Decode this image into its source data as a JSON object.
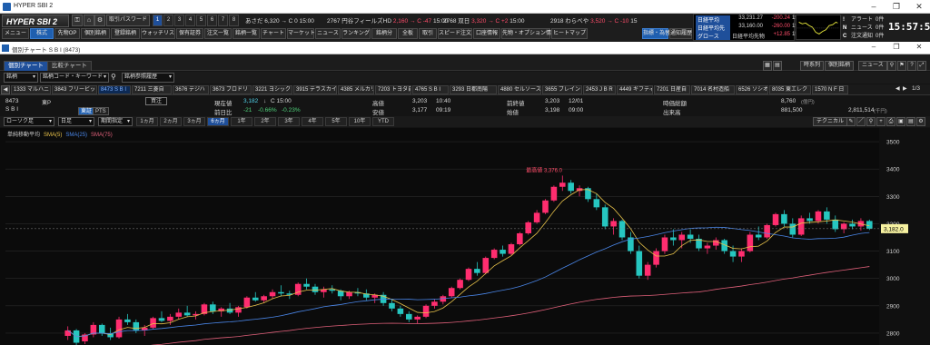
{
  "window": {
    "title": "HYPER SBI 2"
  },
  "toolbar": {
    "brand": "HYPER SBI 2",
    "password_btn": "取引パスワード",
    "num_tabs": [
      "1",
      "2",
      "3",
      "4",
      "5",
      "6",
      "7",
      "8"
    ],
    "tickers": [
      {
        "text": "あさだ 6,320 → C 0 15:00"
      },
      {
        "text": "2767 円谷フィールズHD",
        "price": "2,160",
        "chg": "→ C -47",
        "time": "15:00"
      },
      {
        "text": "2768 双日",
        "price": "3,320",
        "chg": "→ C +2",
        "time": "15:00"
      },
      {
        "text": "2918 わらべや",
        "price": "3,520",
        "chg": "→ C -10",
        "time": "15"
      }
    ],
    "nav_left": [
      "メニュー",
      "株式",
      "先物OP",
      "個別銘柄",
      "登録銘柄",
      "ウォッチリスト",
      "保有証券",
      "注文一覧",
      "銘柄一覧",
      "チャート",
      "マーケット",
      "ニュース",
      "ランキング",
      "銘柄分",
      "全板",
      "取引",
      "スピード注文",
      "口座情報",
      "先物・オプション情報",
      "ヒートマップ"
    ],
    "nav_right": [
      "指標・為替",
      "通知履歴"
    ]
  },
  "indices": [
    {
      "label": "日経平均",
      "value": "33,231.27",
      "chg": "-200.24",
      "time": "15:15"
    },
    {
      "label": "日経平均先",
      "value": "33,160.00",
      "chg": "-260.00",
      "time": "15:15"
    },
    {
      "label": "グロース",
      "value": "日経平均先物",
      "chg": "+12.85",
      "time": "15:15"
    }
  ],
  "alerts": [
    {
      "icon": "!",
      "label": "アラート",
      "count": "0件"
    },
    {
      "icon": "N",
      "label": "ニュース",
      "count": "0件"
    },
    {
      "icon": "C",
      "label": "注文通知",
      "count": "0件"
    }
  ],
  "clock": "15:57:55",
  "subwindow": {
    "title": "個別チャート S B I (8473)"
  },
  "chart_tabs": {
    "tabs": [
      "個別チャート",
      "比較チャート"
    ],
    "right_buttons": [
      "時系列",
      "個別銘柄",
      "ニュース"
    ]
  },
  "search": {
    "type": "銘柄",
    "placeholder": "銘柄コード・キーワード",
    "history": "銘柄参照履歴"
  },
  "stock_tabs": [
    "1333 マルハニ",
    "3843 フリービット",
    "8473 S B I",
    "7211 三菱自",
    "3676 デジハ",
    "3673 ブロドリ",
    "3221 ヨシック",
    "3915 テラスカイ",
    "4385 メルカリ",
    "7203 トヨタ自",
    "4765 S B I",
    "3293 日都南陽",
    "4880 セルソース",
    "3655 ブレイン",
    "2453 J B R",
    "4449 ギフティ",
    "7201 日産自",
    "7014 名村造船",
    "6526 ソシオ",
    "8035 東エレク",
    "1570 N F 日"
  ],
  "stock_tabs_page": "1/3",
  "quote": {
    "code": "8473",
    "name": "S B I",
    "market_label": "東P",
    "markets": [
      "東証",
      "PTS"
    ],
    "buy_btn": "買注",
    "current_label": "現在値",
    "current": "3,182",
    "current_time": "C 15:00",
    "change_label": "前日比",
    "change": "-21",
    "change_pct": "-0.66%",
    "change_pct2": "-0.23%",
    "open_label": "始値",
    "open": "3,203",
    "open_time": "10:40",
    "high_label": "高値",
    "high": "3,203",
    "high_time": "10:40",
    "low_label": "安値",
    "low": "3,177",
    "low_time": "09:19",
    "prev_label": "前終値",
    "prev": "3,203",
    "prev_date": "12/01",
    "start_label": "始値",
    "start": "3,198",
    "start_time": "09:00",
    "value_label": "時価総額",
    "value": "8,760",
    "value_unit": "(億円)",
    "volume_label": "出来高",
    "volume": "881,500",
    "turnover": "2,811,514",
    "turnover_unit": "(千円)"
  },
  "controls": {
    "chart_type": "ローソク足",
    "interval": "日足",
    "period_label": "期間指定",
    "periods": [
      "1ヵ月",
      "2ヵ月",
      "3ヵ月",
      "6ヵ月",
      "1年",
      "2年",
      "3年",
      "4年",
      "5年",
      "10年",
      "YTD"
    ],
    "selected_period": "6ヵ月",
    "technical_btn": "テクニカル"
  },
  "chart_data": {
    "type": "candlestick",
    "legend": [
      "単純移動平均",
      "SMA(5)",
      "SMA(25)",
      "SMA(75)"
    ],
    "legend_colors": [
      "#cccccc",
      "#e8c24a",
      "#4a86e8",
      "#e0607a"
    ],
    "y_ticks": [
      2800,
      2900,
      3000,
      3100,
      3200,
      3300,
      3400,
      3500
    ],
    "ylim": [
      2760,
      3530
    ],
    "annotation": "最高値 3,376.0",
    "last_label": "3,182.0",
    "up_color": "#ff2d6f",
    "down_color": "#26c6c0",
    "candles": [
      [
        2790,
        2825,
        2775,
        2810
      ],
      [
        2810,
        2815,
        2755,
        2765
      ],
      [
        2770,
        2800,
        2760,
        2795
      ],
      [
        2795,
        2840,
        2785,
        2830
      ],
      [
        2830,
        2835,
        2790,
        2800
      ],
      [
        2800,
        2820,
        2775,
        2785
      ],
      [
        2785,
        2860,
        2780,
        2850
      ],
      [
        2850,
        2870,
        2830,
        2840
      ],
      [
        2840,
        2850,
        2800,
        2810
      ],
      [
        2810,
        2830,
        2790,
        2820
      ],
      [
        2820,
        2860,
        2815,
        2855
      ],
      [
        2855,
        2880,
        2840,
        2845
      ],
      [
        2845,
        2870,
        2830,
        2860
      ],
      [
        2860,
        2890,
        2850,
        2875
      ],
      [
        2875,
        2900,
        2860,
        2865
      ],
      [
        2865,
        2880,
        2850,
        2870
      ],
      [
        2870,
        2910,
        2865,
        2905
      ],
      [
        2905,
        2915,
        2870,
        2880
      ],
      [
        2880,
        2895,
        2860,
        2890
      ],
      [
        2890,
        2910,
        2870,
        2875
      ],
      [
        2875,
        2900,
        2860,
        2895
      ],
      [
        2895,
        2935,
        2890,
        2930
      ],
      [
        2930,
        2950,
        2915,
        2920
      ],
      [
        2920,
        2940,
        2910,
        2935
      ],
      [
        2935,
        2960,
        2925,
        2950
      ],
      [
        2950,
        2975,
        2935,
        2945
      ],
      [
        2945,
        2955,
        2925,
        2940
      ],
      [
        2940,
        2985,
        2935,
        2980
      ],
      [
        2980,
        3000,
        2960,
        2970
      ],
      [
        2970,
        2980,
        2940,
        2950
      ],
      [
        2950,
        2970,
        2930,
        2960
      ],
      [
        2960,
        2975,
        2945,
        2955
      ],
      [
        2955,
        2960,
        2920,
        2935
      ],
      [
        2935,
        2955,
        2925,
        2950
      ],
      [
        2950,
        2965,
        2935,
        2945
      ],
      [
        2945,
        2960,
        2920,
        2930
      ],
      [
        2930,
        2945,
        2910,
        2940
      ],
      [
        2940,
        2950,
        2900,
        2910
      ],
      [
        2910,
        2925,
        2880,
        2890
      ],
      [
        2890,
        2900,
        2860,
        2870
      ],
      [
        2870,
        2880,
        2840,
        2850
      ],
      [
        2850,
        2865,
        2835,
        2860
      ],
      [
        2860,
        2905,
        2855,
        2900
      ],
      [
        2900,
        2925,
        2890,
        2915
      ],
      [
        2915,
        2940,
        2905,
        2935
      ],
      [
        2935,
        2970,
        2930,
        2965
      ],
      [
        2965,
        3000,
        2960,
        2995
      ],
      [
        2995,
        3040,
        2990,
        3035
      ],
      [
        3035,
        3060,
        3010,
        3020
      ],
      [
        3020,
        3080,
        3015,
        3075
      ],
      [
        3075,
        3110,
        3070,
        3105
      ],
      [
        3105,
        3120,
        3080,
        3090
      ],
      [
        3090,
        3130,
        3085,
        3125
      ],
      [
        3125,
        3170,
        3120,
        3165
      ],
      [
        3165,
        3210,
        3160,
        3205
      ],
      [
        3205,
        3250,
        3200,
        3240
      ],
      [
        3240,
        3290,
        3235,
        3285
      ],
      [
        3285,
        3340,
        3280,
        3335
      ],
      [
        3335,
        3376,
        3320,
        3350
      ],
      [
        3350,
        3360,
        3310,
        3320
      ],
      [
        3320,
        3340,
        3300,
        3330
      ],
      [
        3330,
        3335,
        3280,
        3290
      ],
      [
        3290,
        3310,
        3250,
        3260
      ],
      [
        3260,
        3270,
        3180,
        3190
      ],
      [
        3190,
        3220,
        3160,
        3210
      ],
      [
        3210,
        3215,
        3140,
        3150
      ],
      [
        3150,
        3170,
        3090,
        3100
      ],
      [
        3100,
        3120,
        3000,
        3010
      ],
      [
        3010,
        3060,
        2995,
        3050
      ],
      [
        3050,
        3110,
        3040,
        3100
      ],
      [
        3100,
        3160,
        3090,
        3150
      ],
      [
        3150,
        3180,
        3120,
        3140
      ],
      [
        3140,
        3170,
        3110,
        3160
      ],
      [
        3160,
        3180,
        3130,
        3145
      ],
      [
        3145,
        3160,
        3100,
        3110
      ],
      [
        3110,
        3130,
        3090,
        3120
      ],
      [
        3120,
        3150,
        3105,
        3140
      ],
      [
        3140,
        3145,
        3090,
        3100
      ],
      [
        3100,
        3120,
        3060,
        3080
      ],
      [
        3080,
        3110,
        3060,
        3100
      ],
      [
        3100,
        3170,
        3095,
        3160
      ],
      [
        3160,
        3190,
        3140,
        3150
      ],
      [
        3150,
        3200,
        3145,
        3195
      ],
      [
        3195,
        3240,
        3190,
        3235
      ],
      [
        3235,
        3250,
        3190,
        3200
      ],
      [
        3200,
        3220,
        3150,
        3160
      ],
      [
        3160,
        3230,
        3155,
        3220
      ],
      [
        3220,
        3240,
        3200,
        3210
      ],
      [
        3210,
        3250,
        3200,
        3245
      ],
      [
        3245,
        3260,
        3200,
        3215
      ],
      [
        3215,
        3230,
        3170,
        3180
      ],
      [
        3180,
        3205,
        3165,
        3200
      ],
      [
        3200,
        3215,
        3180,
        3190
      ],
      [
        3190,
        3220,
        3175,
        3210
      ],
      [
        3210,
        3215,
        3177,
        3182
      ]
    ]
  }
}
